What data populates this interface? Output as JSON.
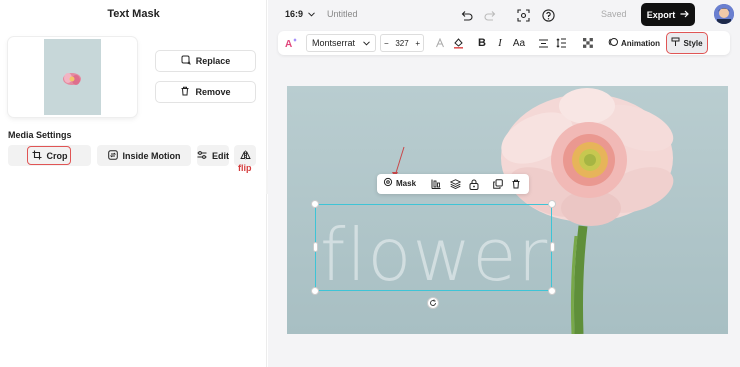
{
  "sidebar": {
    "title": "Text Mask",
    "replace_label": "Replace",
    "remove_label": "Remove",
    "media_settings_label": "Media Settings",
    "crop_label": "Crop",
    "inside_motion_label": "Inside Motion",
    "edit_label": "Edit",
    "flip_label": "flip"
  },
  "topbar": {
    "aspect_ratio": "16:9",
    "document_title": "Untitled",
    "saved_status": "Saved",
    "export_label": "Export"
  },
  "toolbar": {
    "font_family": "Montserrat",
    "font_size": "327",
    "case_label": "Aa",
    "animation_label": "Animation",
    "style_label": "Style"
  },
  "canvas": {
    "text": "flower",
    "mask_label": "Mask"
  },
  "colors": {
    "accent_highlight": "#e05555",
    "selection": "#3ec4d6",
    "export_bg": "#111111",
    "canvas_bg": "#b3c8cb"
  }
}
